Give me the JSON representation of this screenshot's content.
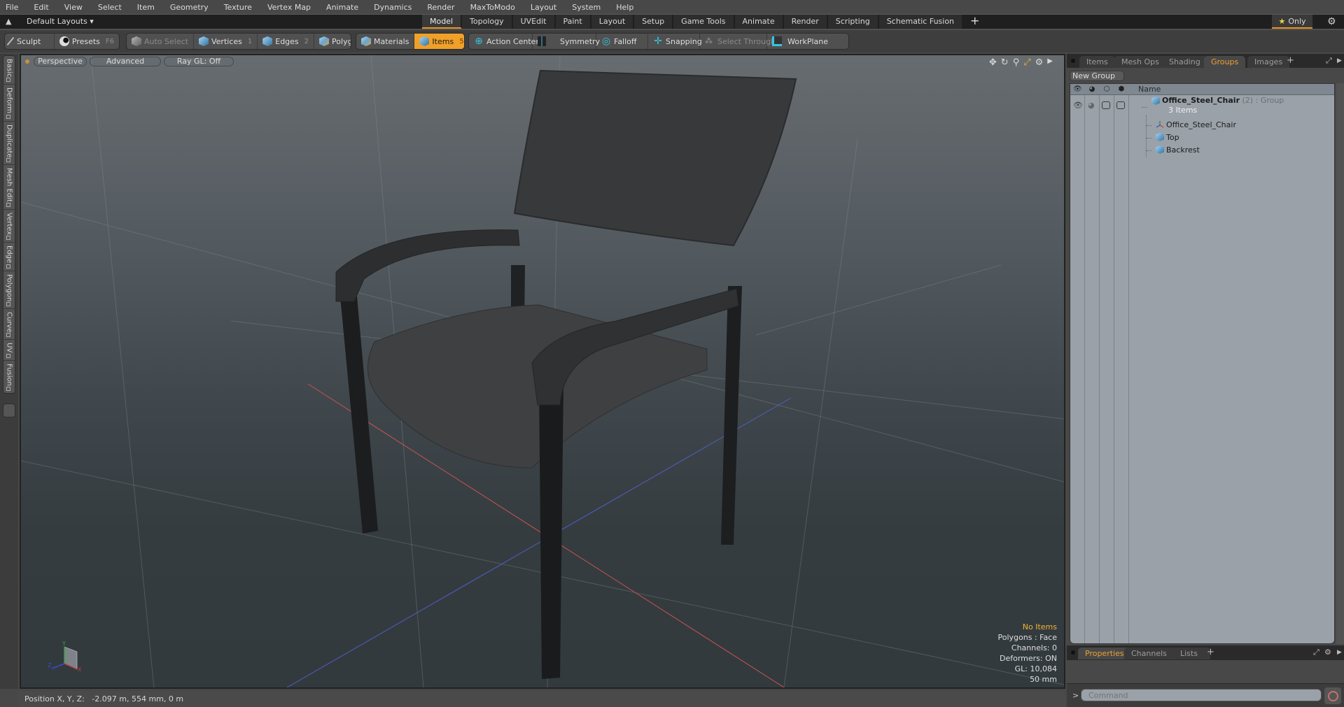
{
  "menu": [
    "File",
    "Edit",
    "View",
    "Select",
    "Item",
    "Geometry",
    "Texture",
    "Vertex Map",
    "Animate",
    "Dynamics",
    "Render",
    "MaxToModo",
    "Layout",
    "System",
    "Help"
  ],
  "layout_bar": {
    "dropdown_label": "Default Layouts ▾",
    "tabs": [
      "Model",
      "Topology",
      "UVEdit",
      "Paint",
      "Layout",
      "Setup",
      "Game Tools",
      "Animate",
      "Render",
      "Scripting",
      "Schematic Fusion"
    ],
    "active_tab": "Model",
    "add_label": "+",
    "only_label": "Only",
    "only_icon": "★"
  },
  "toolbar": {
    "sculpt": "Sculpt",
    "presets": "Presets",
    "presets_key": "F6",
    "auto_select": "Auto Select",
    "vertices": "Vertices",
    "vertices_key": "1",
    "edges": "Edges",
    "edges_key": "2",
    "polygons": "Polygons",
    "materials": "Materials",
    "items": "Items",
    "items_key": "5",
    "action_center": "Action Center",
    "symmetry": "Symmetry",
    "falloff": "Falloff",
    "snapping": "Snapping",
    "select_through": "Select Through",
    "workplane": "WorkPlane"
  },
  "left_tabs": [
    "Basic",
    "Deform",
    "Duplicate",
    "Mesh Edit",
    "Vertex",
    "Edge",
    "Polygon",
    "Curve",
    "UV",
    "Fusion"
  ],
  "viewport": {
    "view_mode": "Perspective",
    "shading": "Advanced",
    "raygl": "Ray GL: Off",
    "stats": {
      "selection": "No Items",
      "polygons": "Polygons : Face",
      "channels": "Channels: 0",
      "deformers": "Deformers: ON",
      "gl": "GL: 10,084",
      "grid": "50 mm"
    },
    "axis_labels": {
      "y": "Y",
      "z": "Z",
      "x": "X"
    }
  },
  "status_bar": {
    "position": "Position X, Y, Z:   -2.097 m, 554 mm, 0 m"
  },
  "right_panel": {
    "tabs": [
      "Items",
      "Mesh Ops",
      "Shading",
      "Groups",
      "Images"
    ],
    "active_tab": "Groups",
    "new_group": "New Group",
    "column_name": "Name",
    "group": {
      "name": "Office_Steel_Chair",
      "count": "(2)",
      "type": ": Group",
      "subtitle": "3 Items",
      "children": [
        {
          "name": "Office_Steel_Chair",
          "icon": "locator-icon"
        },
        {
          "name": "Top",
          "icon": "mesh-icon"
        },
        {
          "name": "Backrest",
          "icon": "mesh-icon"
        }
      ]
    }
  },
  "bottom_panel": {
    "tabs": [
      "Properties",
      "Channels",
      "Lists"
    ],
    "active_tab": "Properties",
    "command_placeholder": "Command",
    "prompt": ">"
  },
  "colors": {
    "accent": "#e8951e",
    "active_tool": "#f0a028",
    "active_tab_text": "#eea033",
    "warning_text": "#f3b23a"
  }
}
